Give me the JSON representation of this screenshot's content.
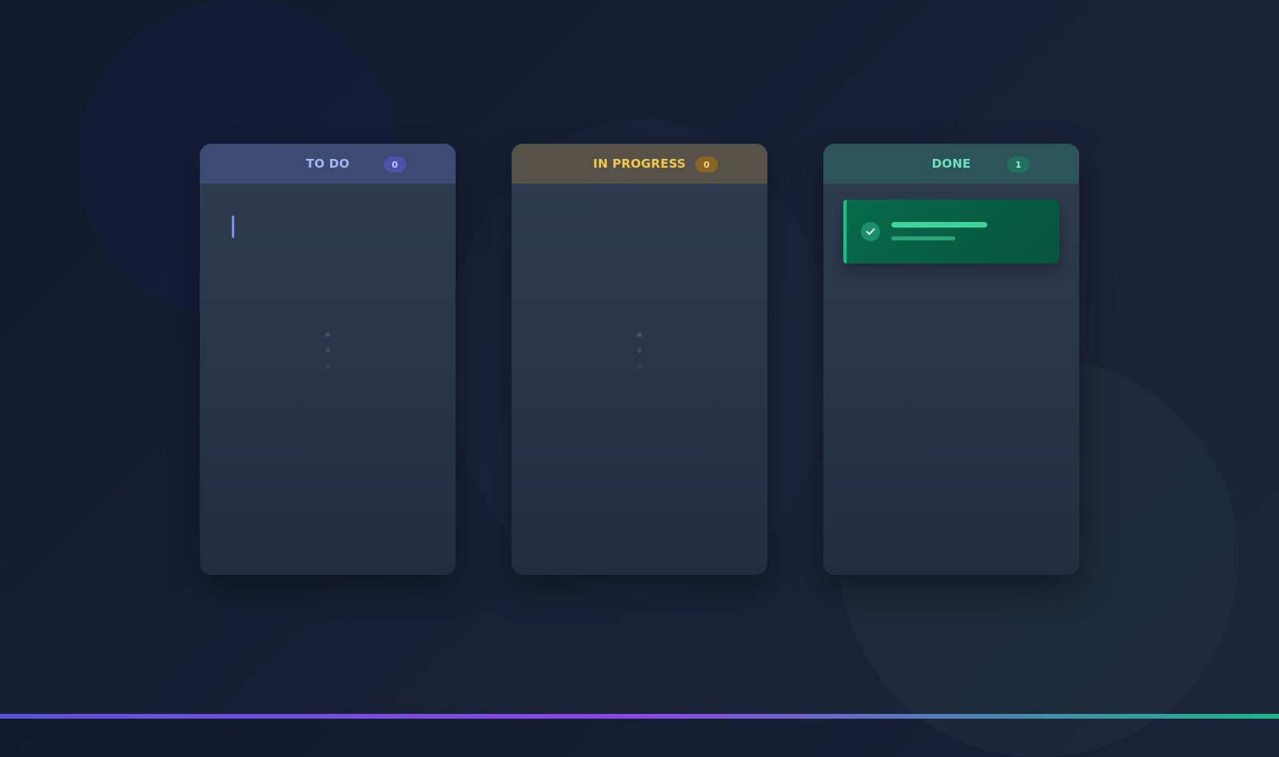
{
  "board": {
    "columns": [
      {
        "title": "TO DO",
        "count": "0",
        "color": "#a7b4f4"
      },
      {
        "title": "IN PROGRESS",
        "count": "0",
        "color": "#f2c94c"
      },
      {
        "title": "DONE",
        "count": "1",
        "color": "#6fe0bd"
      }
    ],
    "done_card_status_icon": "check-icon",
    "accent_colors": {
      "todo": "#4b52a8",
      "in_progress": "#8a6424",
      "done": "#15c587"
    }
  }
}
